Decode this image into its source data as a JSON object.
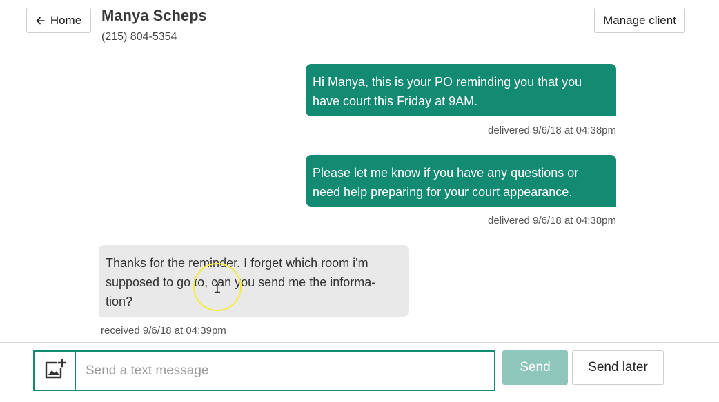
{
  "header": {
    "home_label": "Home",
    "client_name": "Manya Scheps",
    "client_phone": "(215) 804-5354",
    "manage_label": "Manage client"
  },
  "messages": [
    {
      "direction": "sent",
      "text": "Hi Manya, this is your PO reminding you that you have court this Friday at 9AM.",
      "status": "delivered 9/6/18 at 04:38pm"
    },
    {
      "direction": "sent",
      "text": "Please let me know if you have any questions or need help preparing for your court appearance.",
      "status": "delivered 9/6/18 at 04:38pm"
    },
    {
      "direction": "received",
      "text": "Thanks for the reminder. I forget which room i'm supposed to go to, can you send me the informa-tion?",
      "status": "received 9/6/18 at 04:39pm"
    }
  ],
  "compose": {
    "placeholder": "Send a text message",
    "value": "",
    "send_label": "Send",
    "send_later_label": "Send later",
    "attach_icon": "add-image-icon"
  },
  "colors": {
    "accent": "#138a72",
    "send_disabled": "#8fc6bb",
    "received_bubble": "#e9e9e9"
  }
}
